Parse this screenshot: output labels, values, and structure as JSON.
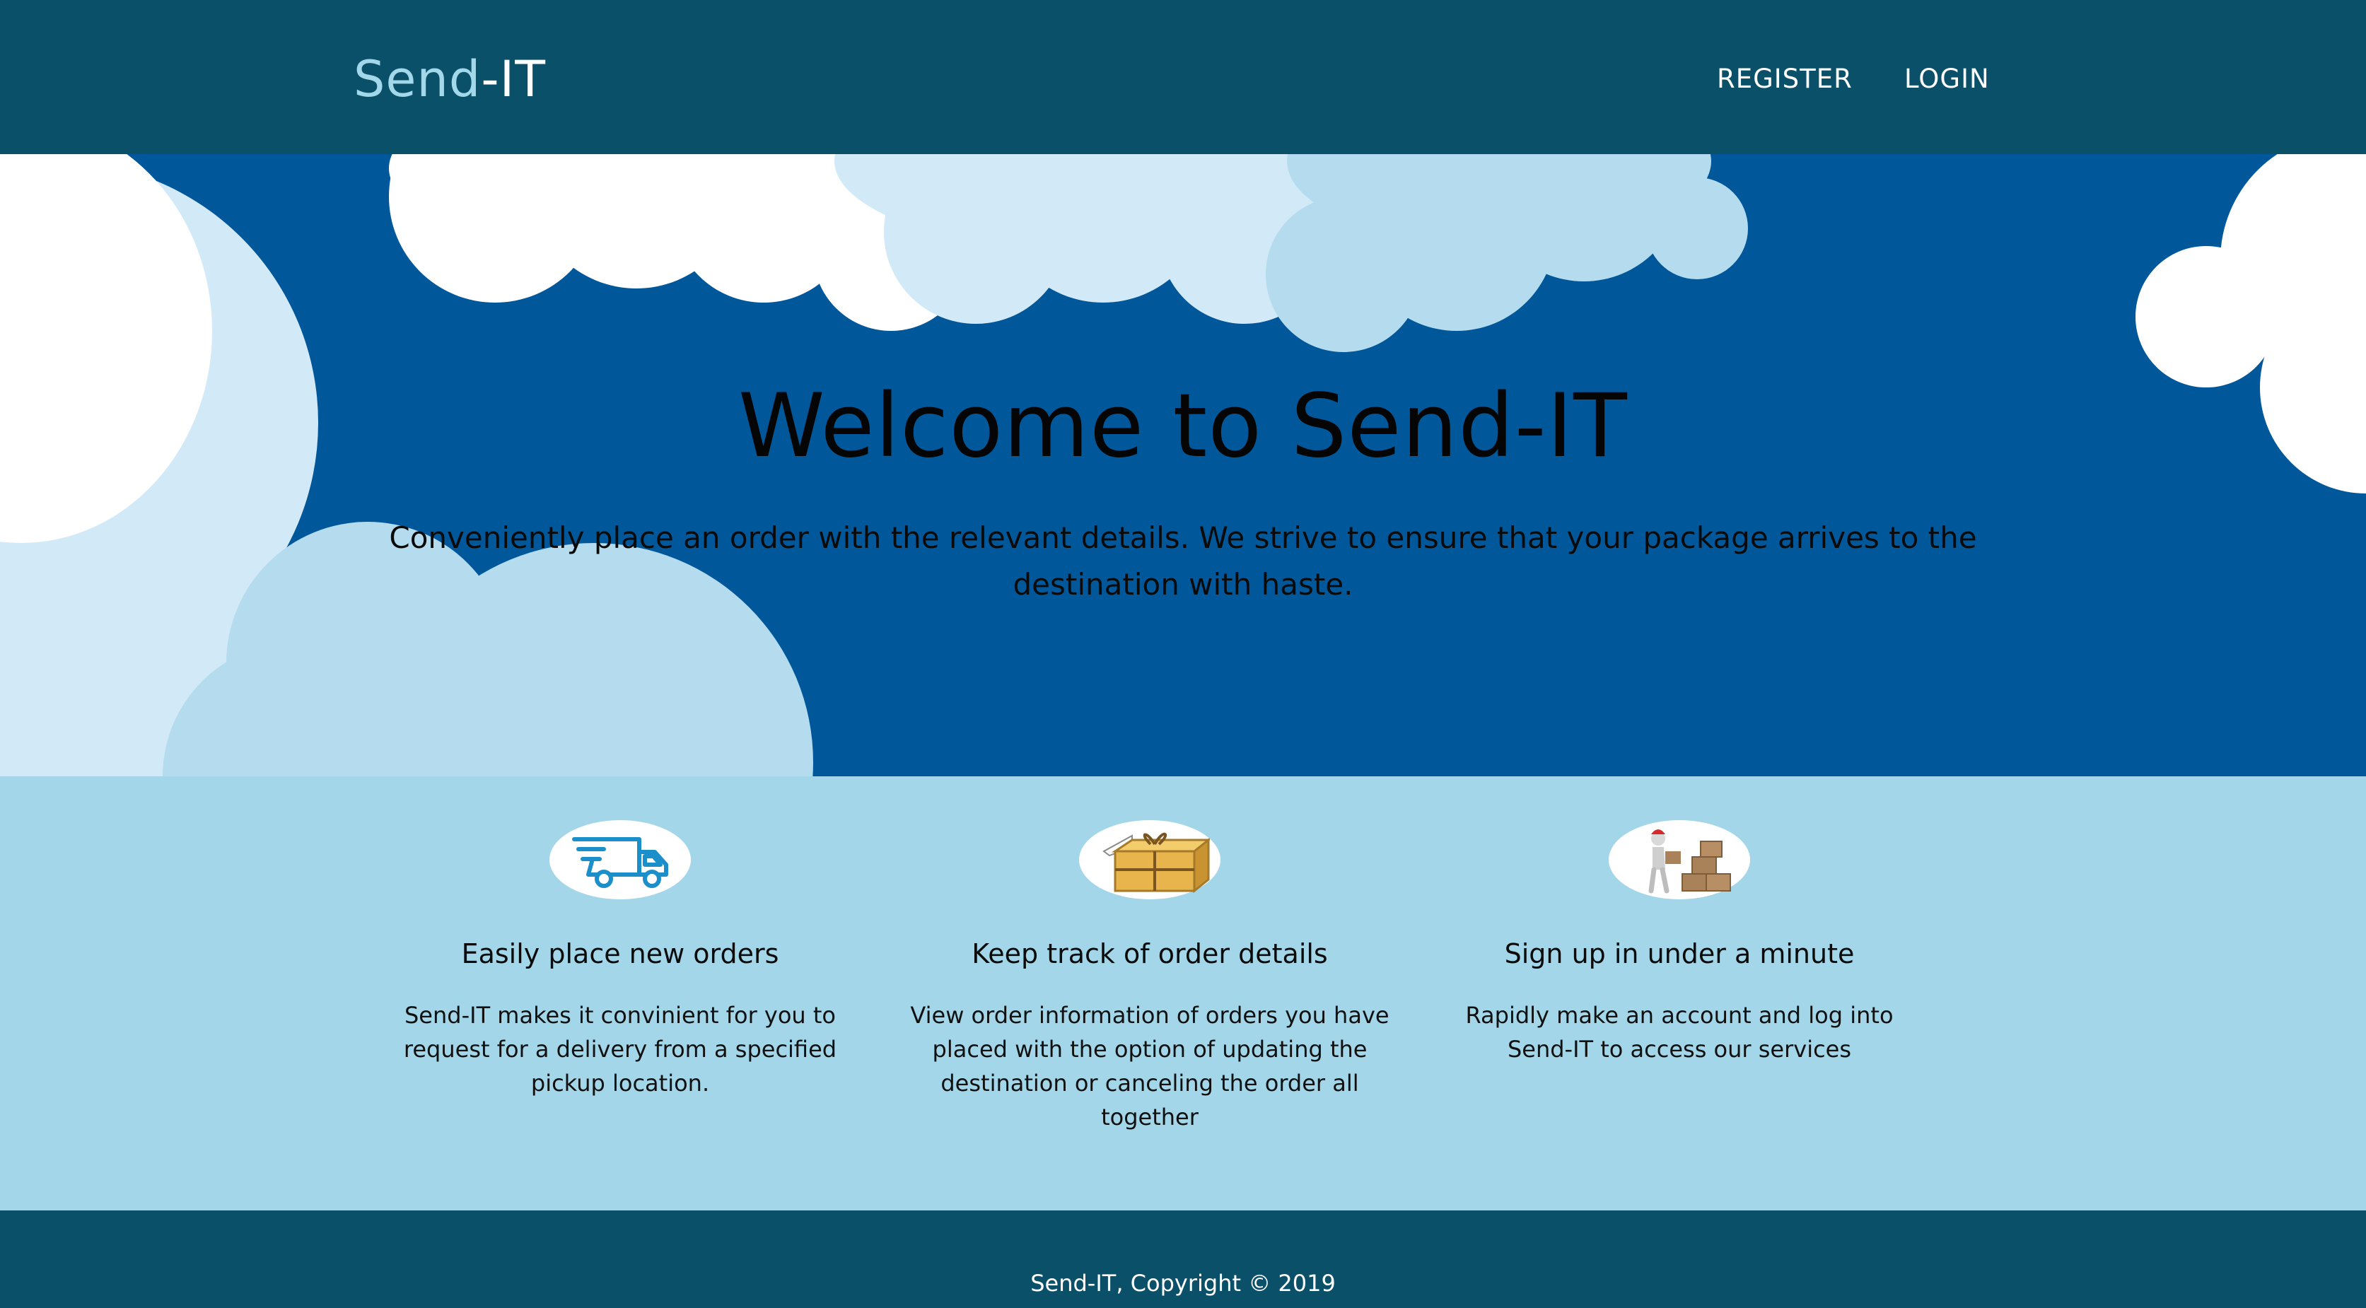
{
  "navbar": {
    "brand_part1": "Send",
    "brand_part2": "-IT",
    "links": [
      "REGISTER",
      "LOGIN"
    ]
  },
  "hero": {
    "title": "Welcome to Send-IT",
    "subtitle": "Conveniently place an order with the relevant details. We strive to ensure that your package arrives to the destination with haste."
  },
  "features": [
    {
      "icon": "delivery-truck-icon",
      "title": "Easily place new orders",
      "text": "Send-IT makes it convinient for you to request for a delivery from a specified pickup location."
    },
    {
      "icon": "package-icon",
      "title": "Keep track of order details",
      "text": "View order information of orders you have placed with the option of updating the destination or canceling the order all together"
    },
    {
      "icon": "person-boxes-icon",
      "title": "Sign up in under a minute",
      "text": "Rapidly make an account and log into Send-IT to access our services"
    }
  ],
  "footer": {
    "text": "Send-IT, Copyright © 2019"
  },
  "colors": {
    "navbar": "#0a5068",
    "brand_accent": "#a3d7ea",
    "hero_sky": "#00579a",
    "features_bg": "#a3d6e8",
    "truck_icon": "#1a8fc9"
  }
}
